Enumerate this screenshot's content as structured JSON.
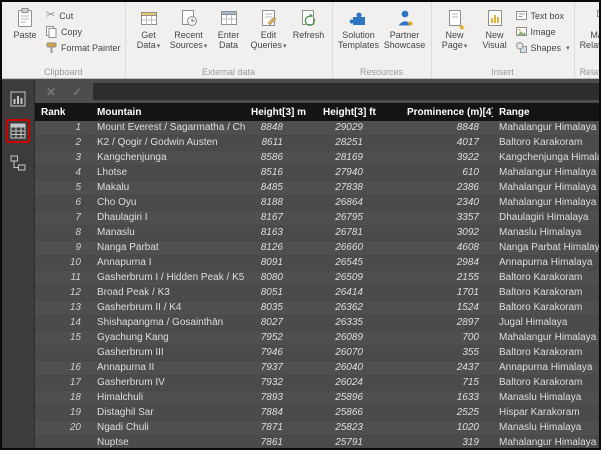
{
  "ribbon": {
    "group_labels": [
      "Clipboard",
      "External data",
      "Resources",
      "Insert",
      "Relationships"
    ],
    "clipboard": {
      "paste": "Paste",
      "cut": "Cut",
      "copy": "Copy",
      "format_painter": "Format Painter"
    },
    "external_data": {
      "get_data": "Get Data",
      "recent_sources": "Recent Sources",
      "enter_data": "Enter Data",
      "edit_queries": "Edit Queries",
      "refresh": "Refresh"
    },
    "resources": {
      "solution_templates": "Solution Templates",
      "partner_showcase": "Partner Showcase"
    },
    "insert": {
      "new_page": "New Page",
      "new_visual": "New Visual",
      "text_box": "Text box",
      "image": "Image",
      "shapes": "Shapes"
    },
    "relationships": {
      "manage_relationships": "Manage Relationships"
    }
  },
  "icons": {
    "cut": "✂",
    "chevron_down": "▾",
    "close": "✕",
    "check": "✓",
    "star": "★"
  },
  "sidebar": {
    "items": [
      {
        "name": "report-view",
        "selected": false
      },
      {
        "name": "data-view",
        "selected": true
      },
      {
        "name": "relationships-view",
        "selected": false
      }
    ]
  },
  "table": {
    "columns": [
      "Rank",
      "Mountain",
      "Height[3] m",
      "Height[3] ft",
      "Prominence (m)[4]",
      "Range"
    ],
    "rows": [
      [
        "1",
        "Mount Everest / Sagarmatha / Chomolungma",
        "8848",
        "29029",
        "8848",
        "Mahalangur Himalaya"
      ],
      [
        "2",
        "K2 / Qogir / Godwin Austen",
        "8611",
        "28251",
        "4017",
        "Baltoro Karakoram"
      ],
      [
        "3",
        "Kangchenjunga",
        "8586",
        "28169",
        "3922",
        "Kangchenjunga Himalaya"
      ],
      [
        "4",
        "Lhotse",
        "8516",
        "27940",
        "610",
        "Mahalangur Himalaya"
      ],
      [
        "5",
        "Makalu",
        "8485",
        "27838",
        "2386",
        "Mahalangur Himalaya"
      ],
      [
        "6",
        "Cho Oyu",
        "8188",
        "26864",
        "2340",
        "Mahalangur Himalaya"
      ],
      [
        "7",
        "Dhaulagiri I",
        "8167",
        "26795",
        "3357",
        "Dhaulagiri Himalaya"
      ],
      [
        "8",
        "Manaslu",
        "8163",
        "26781",
        "3092",
        "Manaslu Himalaya"
      ],
      [
        "9",
        "Nanga Parbat",
        "8126",
        "26660",
        "4608",
        "Nanga Parbat Himalaya"
      ],
      [
        "10",
        "Annapurna I",
        "8091",
        "26545",
        "2984",
        "Annapurna Himalaya"
      ],
      [
        "11",
        "Gasherbrum I / Hidden Peak / K5",
        "8080",
        "26509",
        "2155",
        "Baltoro Karakoram"
      ],
      [
        "12",
        "Broad Peak / K3",
        "8051",
        "26414",
        "1701",
        "Baltoro Karakoram"
      ],
      [
        "13",
        "Gasherbrum II / K4",
        "8035",
        "26362",
        "1524",
        "Baltoro Karakoram"
      ],
      [
        "14",
        "Shishapangma / Gosainthān",
        "8027",
        "26335",
        "2897",
        "Jugal Himalaya"
      ],
      [
        "15",
        "Gyachung Kang",
        "7952",
        "26089",
        "700",
        "Mahalangur Himalaya"
      ],
      [
        "",
        "Gasherbrum III",
        "7946",
        "26070",
        "355",
        "Baltoro Karakoram"
      ],
      [
        "16",
        "Annapurna II",
        "7937",
        "26040",
        "2437",
        "Annapurna Himalaya"
      ],
      [
        "17",
        "Gasherbrum IV",
        "7932",
        "26024",
        "715",
        "Baltoro Karakoram"
      ],
      [
        "18",
        "Himalchuli",
        "7893",
        "25896",
        "1633",
        "Manaslu Himalaya"
      ],
      [
        "19",
        "Distaghil Sar",
        "7884",
        "25866",
        "2525",
        "Hispar Karakoram"
      ],
      [
        "20",
        "Ngadi Chuli",
        "7871",
        "25823",
        "1020",
        "Manaslu Himalaya"
      ],
      [
        "",
        "Nuptse",
        "7861",
        "25791",
        "319",
        "Mahalangur Himalaya"
      ]
    ]
  }
}
